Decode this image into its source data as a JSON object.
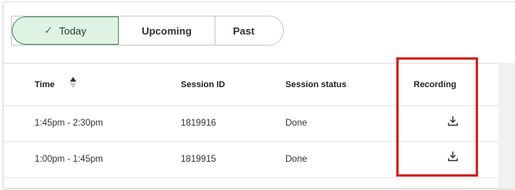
{
  "tabs": {
    "today": "Today",
    "upcoming": "Upcoming",
    "past": "Past",
    "selected": "Today"
  },
  "table": {
    "columns": [
      "Time",
      "Session ID",
      "Session status",
      "Recording"
    ],
    "rows": [
      {
        "time": "1:45pm - 2:30pm",
        "session_id": "1819916",
        "status": "Done",
        "recording": "download-icon"
      },
      {
        "time": "1:00pm - 1:45pm",
        "session_id": "1819915",
        "status": "Done",
        "recording": "download-icon"
      }
    ],
    "sort": {
      "column": "Time",
      "direction": "ascending"
    }
  },
  "colors": {
    "selected_tab_bg": "#dff3e4",
    "selected_tab_border": "#3f8f56",
    "highlight": "#d9201f"
  }
}
